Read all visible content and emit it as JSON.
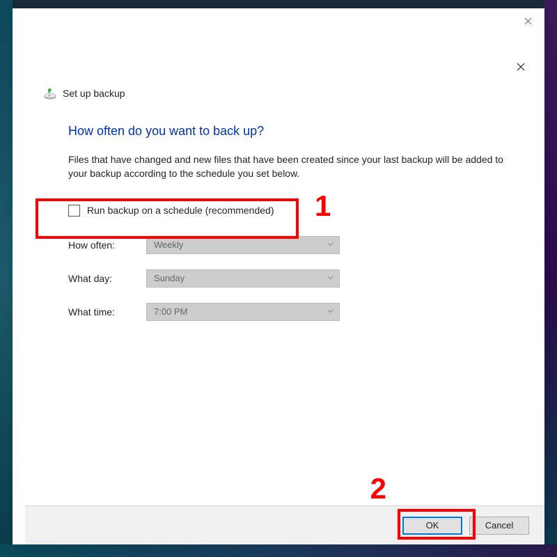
{
  "outer": {
    "close_tooltip": "Close"
  },
  "dialog": {
    "title": "Set up backup",
    "heading": "How often do you want to back up?",
    "description": "Files that have changed and new files that have been created since your last backup will be added to your backup according to the schedule you set below.",
    "schedule_checkbox_label": "Run backup on a schedule (recommended)",
    "schedule_checked": false,
    "fields": {
      "how_often_label": "How often:",
      "how_often_value": "Weekly",
      "what_day_label": "What day:",
      "what_day_value": "Sunday",
      "what_time_label": "What time:",
      "what_time_value": "7:00 PM"
    },
    "buttons": {
      "ok": "OK",
      "cancel": "Cancel"
    }
  },
  "annotations": {
    "mark1": "1",
    "mark2": "2"
  }
}
